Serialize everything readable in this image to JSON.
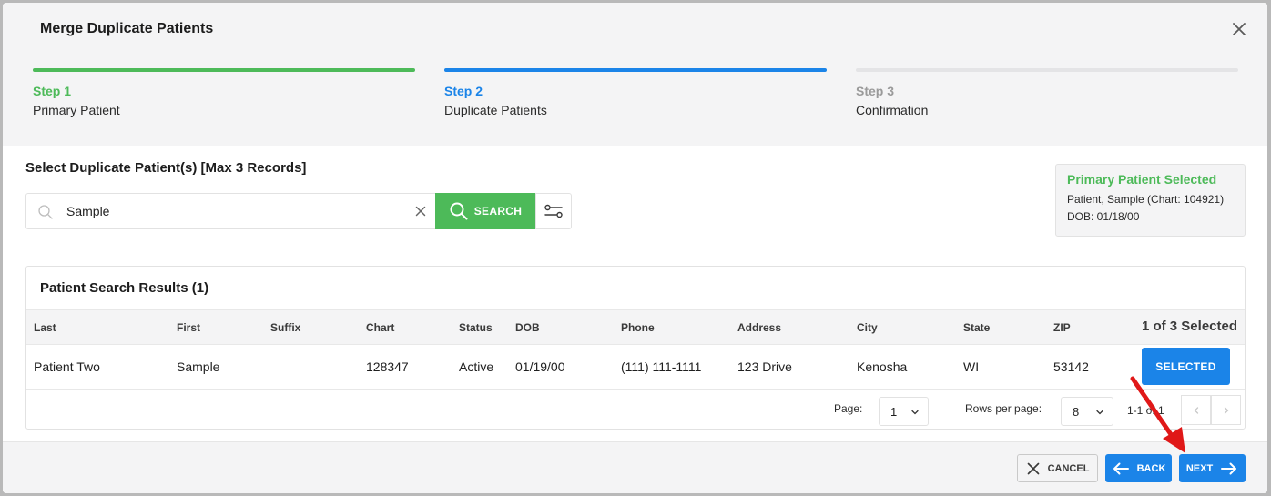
{
  "modal": {
    "title": "Merge Duplicate Patients"
  },
  "stepper": {
    "steps": [
      {
        "label": "Step 1",
        "name": "Primary Patient",
        "color": "#4dba59",
        "state": "complete"
      },
      {
        "label": "Step 2",
        "name": "Duplicate Patients",
        "color": "#1b84e8",
        "state": "active"
      },
      {
        "label": "Step 3",
        "name": "Confirmation",
        "color": "#9a9a9a",
        "state": "pending"
      }
    ]
  },
  "search": {
    "section_title": "Select Duplicate Patient(s) [Max 3 Records]",
    "value": "Sample",
    "button_label": "SEARCH"
  },
  "primary_patient": {
    "heading": "Primary Patient Selected",
    "line1": "Patient, Sample (Chart: 104921)",
    "line2": "DOB: 01/18/00"
  },
  "results": {
    "title": "Patient Search Results (1)",
    "columns": [
      "Last",
      "First",
      "Suffix",
      "Chart",
      "Status",
      "DOB",
      "Phone",
      "Address",
      "City",
      "State",
      "ZIP"
    ],
    "selected_count": "1 of 3 Selected",
    "rows": [
      {
        "last": "Patient Two",
        "first": "Sample",
        "suffix": "",
        "chart": "128347",
        "status": "Active",
        "dob": "01/19/00",
        "phone": "(111) 111-1111",
        "address": "123 Drive",
        "city": "Kenosha",
        "state": "WI",
        "zip": "53142",
        "action_label": "SELECTED"
      }
    ],
    "pagination": {
      "page_label": "Page:",
      "page_value": "1",
      "rows_label": "Rows per page:",
      "rows_value": "8",
      "range_text": "1-1 of 1"
    }
  },
  "footer": {
    "cancel_label": "CANCEL",
    "back_label": "BACK",
    "next_label": "NEXT"
  },
  "colors": {
    "accent_green": "#4dba59",
    "accent_blue": "#1b84e8",
    "annotation_red": "#e01818"
  }
}
